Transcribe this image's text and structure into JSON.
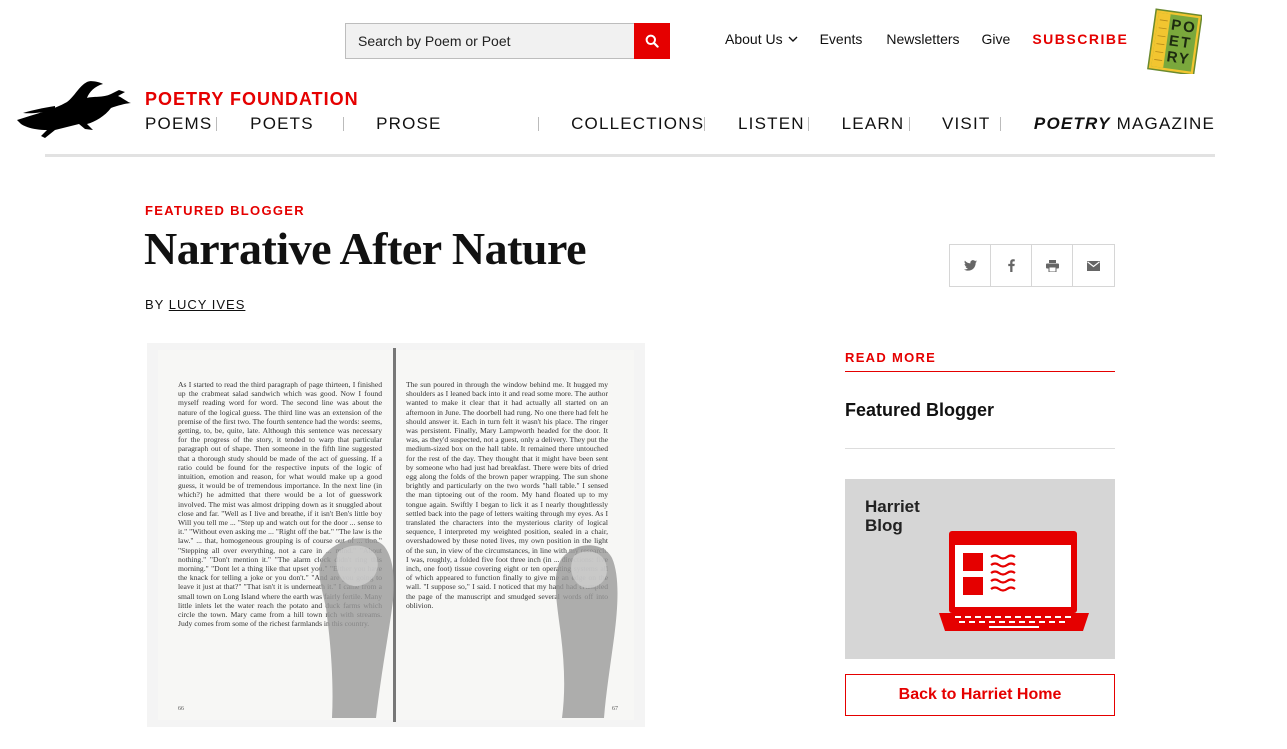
{
  "search": {
    "placeholder": "Search by Poem or Poet"
  },
  "utility_nav": {
    "about": "About Us",
    "events": "Events",
    "newsletters": "Newsletters",
    "give": "Give",
    "subscribe": "SUBSCRIBE"
  },
  "magazine_logo": {
    "letters": [
      "P",
      "O",
      "E",
      "T",
      "R",
      "Y"
    ]
  },
  "brand": "POETRY FOUNDATION",
  "main_nav": [
    {
      "label": "POEMS"
    },
    {
      "label": "POETS"
    },
    {
      "label": "PROSE"
    },
    {
      "label": "COLLECTIONS"
    },
    {
      "label": "LISTEN"
    },
    {
      "label": "LEARN"
    },
    {
      "label": "VISIT"
    },
    {
      "label_em": "POETRY",
      "label": " MAGAZINE"
    }
  ],
  "article": {
    "kicker": "FEATURED BLOGGER",
    "title": "Narrative After Nature",
    "by_prefix": "BY ",
    "author": "LUCY IVES"
  },
  "share_icons": [
    "twitter-icon",
    "facebook-icon",
    "print-icon",
    "email-icon"
  ],
  "book": {
    "left_text": "As I started to read the third paragraph of page thirteen, I finished up the crabmeat salad sandwich which was good. Now I found myself reading word for word. The second line was about the nature of the logical guess. The third line was an extension of the premise of the first two. The fourth sentence had the words: seems, getting, to, be, quite, late. Although this sentence was necessary for the progress of the story, it tended to warp that particular paragraph out of shape. Then someone in the fifth line suggested that a thorough study should be made of the act of guessing. If a ratio could be found for the respective inputs of the logic of intuition, emotion and reason, for what would make up a good guess, it would be of tremendous importance. In the next line (in which?) he admitted that there would be a lot of guesswork involved. The mist was almost dripping down as it snuggled about close and far. \"Well as I live and breathe, if it isn't Ben's little boy Will you tell me ... \"Step up and watch out for the door ... sense to it.\" \"Without even asking me ... \"Right off the bat.\" \"The law is the law.\" ... that, homogeneous grouping is of course out of ... tion.\" \"Stepping all over everything, not a care in ... mind.\" \"About nothing.\" \"Don't mention it.\" \"The alarm clock didn't ring this morning.\" \"Dont let a thing like that upset you.\" \"Either you have the knack for telling a joke or you don't.\" \"And are you going to leave it just at that?\" \"That isn't it is underneath it.\" I came from a small town on Long Island where the earth was fairly fertile. Many little inlets let the water reach the potato and duck farms which circle the town. Mary came from a hill town rich with streams. Judy comes from some of the richest farmlands in this country.",
    "right_text": "The sun poured in through the window behind me. It hugged my shoulders as I leaned back into it and read some more. The author wanted to make it clear that it had actually all started on an afternoon in June. The doorbell had rung. No one there had felt he should answer it. Each in turn felt it wasn't his place. The ringer was persistent. Finally, Mary Lampworth headed for the door. It was, as they'd suspected, not a guest, only a delivery. They put the medium-sized box on the hall table. It remained there untouched for the rest of the day. They thought that it might have been sent by someone who had just had breakfast. There were bits of dried egg along the folds of the brown paper wrapping. The sun shone brightly and particularly on the two words \"hall table.\" I sensed the man tiptoeing out of the room. My hand floated up to my tongue again. Swiftly I began to lick it as I nearly thoughtlessly settled back into the page of letters waiting through my eyes. As I translated the characters into the mysterious clarity of logical sequence, I interpreted my weighted position, sealed in a chair, overshadowed by these noted lives, my own position in the light of the sun, in view of the circumstances, in line with my research. I was, roughly, a folded five foot three inch (in ... directions: five inch, one foot) tissue covering eight or ten operating systems all of which appeared to function finally to give me an edge on the wall. \"I suppose so,\" I said. I noticed that my hand had crumpled the page of the manuscript and smudged several words off into oblivion.",
    "left_page_number": "66",
    "right_page_number": "67"
  },
  "sidebar": {
    "read_more": "READ MORE",
    "featured_link": "Featured Blogger",
    "promo_line1": "Harriet",
    "promo_line2": "Blog",
    "back_button": "Back to Harriet Home"
  },
  "colors": {
    "accent": "#e50000",
    "promo_bg": "#d6d6d6"
  }
}
